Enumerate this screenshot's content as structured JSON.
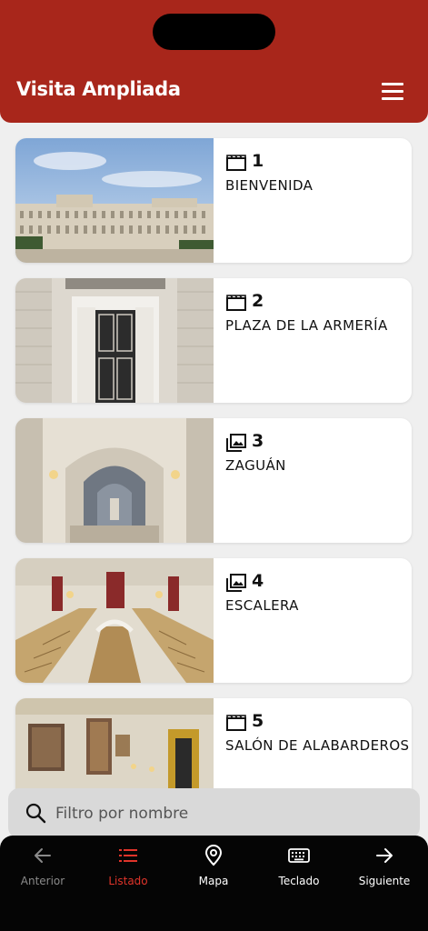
{
  "header": {
    "title": "Visita Ampliada",
    "menu_icon": "hamburger-menu-icon",
    "bg_color": "#a8261b"
  },
  "items": [
    {
      "number": "1",
      "name": "BIENVENIDA",
      "type_icon": "video-icon"
    },
    {
      "number": "2",
      "name": "PLAZA DE LA ARMERÍA",
      "type_icon": "video-icon"
    },
    {
      "number": "3",
      "name": "ZAGUÁN",
      "type_icon": "gallery-icon"
    },
    {
      "number": "4",
      "name": "ESCALERA",
      "type_icon": "gallery-icon"
    },
    {
      "number": "5",
      "name": "SALÓN DE ALABARDEROS",
      "type_icon": "video-icon"
    }
  ],
  "filter": {
    "placeholder": "Filtro por nombre"
  },
  "tabbar": {
    "tabs": [
      {
        "label": "Anterior",
        "icon": "arrow-left-icon"
      },
      {
        "label": "Listado",
        "icon": "list-icon"
      },
      {
        "label": "Mapa",
        "icon": "map-pin-icon"
      },
      {
        "label": "Teclado",
        "icon": "keyboard-icon"
      },
      {
        "label": "Siguiente",
        "icon": "arrow-right-icon"
      }
    ],
    "active_color": "#e0342a"
  }
}
